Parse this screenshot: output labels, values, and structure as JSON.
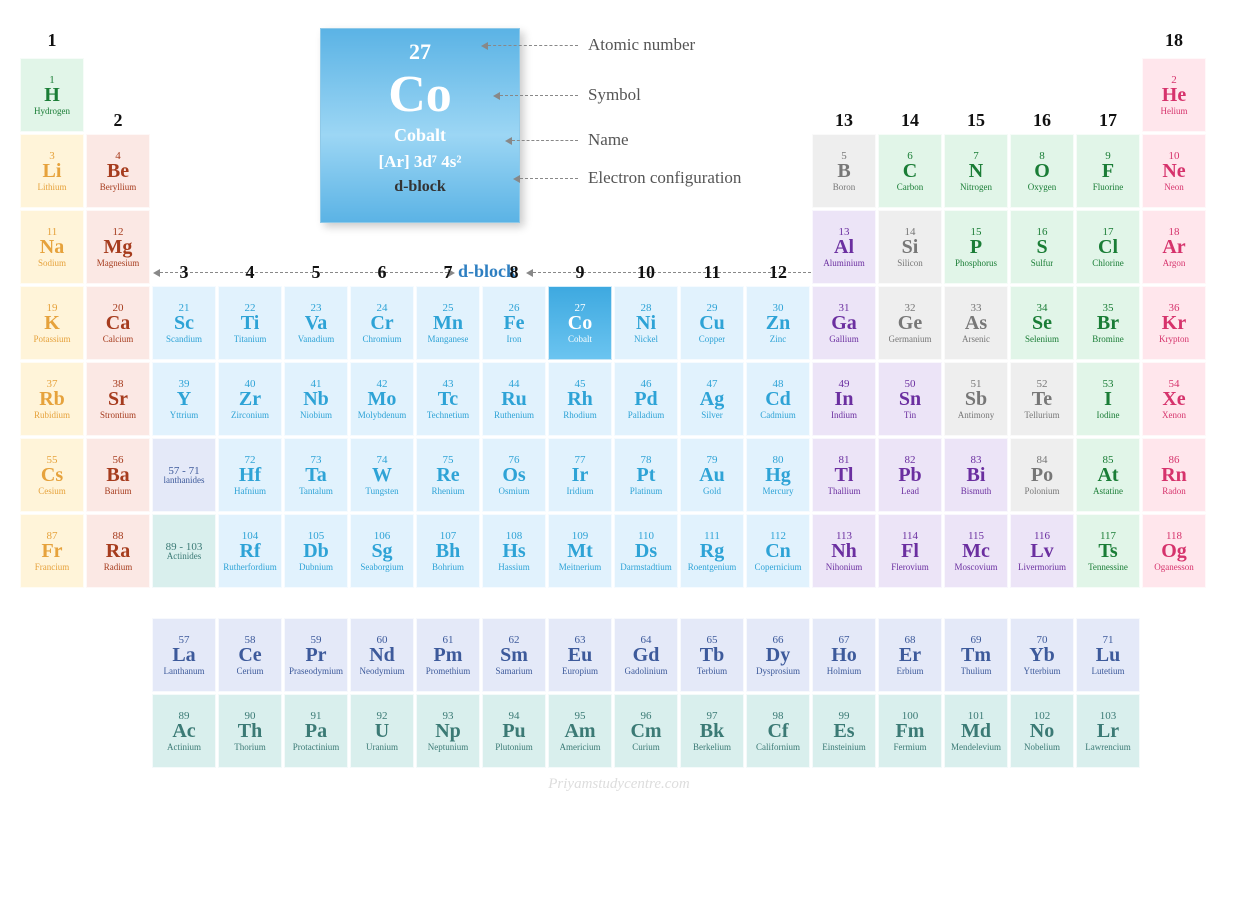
{
  "highlight_element": {
    "number": "27",
    "symbol": "Co",
    "name": "Cobalt",
    "electron_config": "[Ar] 3d⁷ 4s²",
    "block": "d-block"
  },
  "legend": {
    "atomic_number": "Atomic number",
    "symbol": "Symbol",
    "name": "Name",
    "electron_configuration": "Electron configuration"
  },
  "dblock_label": "d-block",
  "watermark": "Priyamstudycentre.com",
  "groups": [
    "1",
    "2",
    "3",
    "4",
    "5",
    "6",
    "7",
    "8",
    "9",
    "10",
    "11",
    "12",
    "13",
    "14",
    "15",
    "16",
    "17",
    "18"
  ],
  "lanth_label": {
    "range": "57 - 71",
    "text": "lanthanides"
  },
  "act_label": {
    "range": "89 - 103",
    "text": "Actinides"
  },
  "elements": [
    {
      "z": 1,
      "s": "H",
      "n": "Hydrogen",
      "cat": "nonmetal",
      "row": 0,
      "col": 0
    },
    {
      "z": 2,
      "s": "He",
      "n": "Helium",
      "cat": "noble",
      "row": 0,
      "col": 17
    },
    {
      "z": 3,
      "s": "Li",
      "n": "Lithium",
      "cat": "alkali",
      "row": 1,
      "col": 0
    },
    {
      "z": 4,
      "s": "Be",
      "n": "Beryllium",
      "cat": "alkearth",
      "row": 1,
      "col": 1
    },
    {
      "z": 5,
      "s": "B",
      "n": "Boron",
      "cat": "metalloid",
      "row": 1,
      "col": 12
    },
    {
      "z": 6,
      "s": "C",
      "n": "Carbon",
      "cat": "nonmetal",
      "row": 1,
      "col": 13
    },
    {
      "z": 7,
      "s": "N",
      "n": "Nitrogen",
      "cat": "nonmetal",
      "row": 1,
      "col": 14
    },
    {
      "z": 8,
      "s": "O",
      "n": "Oxygen",
      "cat": "nonmetal",
      "row": 1,
      "col": 15
    },
    {
      "z": 9,
      "s": "F",
      "n": "Fluorine",
      "cat": "nonmetal",
      "row": 1,
      "col": 16
    },
    {
      "z": 10,
      "s": "Ne",
      "n": "Neon",
      "cat": "noble",
      "row": 1,
      "col": 17
    },
    {
      "z": 11,
      "s": "Na",
      "n": "Sodium",
      "cat": "alkali",
      "row": 2,
      "col": 0
    },
    {
      "z": 12,
      "s": "Mg",
      "n": "Magnesium",
      "cat": "alkearth",
      "row": 2,
      "col": 1
    },
    {
      "z": 13,
      "s": "Al",
      "n": "Aluminium",
      "cat": "ptrans",
      "row": 2,
      "col": 12
    },
    {
      "z": 14,
      "s": "Si",
      "n": "Silicon",
      "cat": "metalloid",
      "row": 2,
      "col": 13
    },
    {
      "z": 15,
      "s": "P",
      "n": "Phosphorus",
      "cat": "nonmetal",
      "row": 2,
      "col": 14
    },
    {
      "z": 16,
      "s": "S",
      "n": "Sulfur",
      "cat": "nonmetal",
      "row": 2,
      "col": 15
    },
    {
      "z": 17,
      "s": "Cl",
      "n": "Chlorine",
      "cat": "nonmetal",
      "row": 2,
      "col": 16
    },
    {
      "z": 18,
      "s": "Ar",
      "n": "Argon",
      "cat": "noble",
      "row": 2,
      "col": 17
    },
    {
      "z": 19,
      "s": "K",
      "n": "Potassium",
      "cat": "alkali",
      "row": 3,
      "col": 0
    },
    {
      "z": 20,
      "s": "Ca",
      "n": "Calcium",
      "cat": "alkearth",
      "row": 3,
      "col": 1
    },
    {
      "z": 21,
      "s": "Sc",
      "n": "Scandium",
      "cat": "trans",
      "row": 3,
      "col": 2
    },
    {
      "z": 22,
      "s": "Ti",
      "n": "Titanium",
      "cat": "trans",
      "row": 3,
      "col": 3
    },
    {
      "z": 23,
      "s": "Va",
      "n": "Vanadium",
      "cat": "trans",
      "row": 3,
      "col": 4
    },
    {
      "z": 24,
      "s": "Cr",
      "n": "Chromium",
      "cat": "trans",
      "row": 3,
      "col": 5
    },
    {
      "z": 25,
      "s": "Mn",
      "n": "Manganese",
      "cat": "trans",
      "row": 3,
      "col": 6
    },
    {
      "z": 26,
      "s": "Fe",
      "n": "Iron",
      "cat": "trans",
      "row": 3,
      "col": 7
    },
    {
      "z": 27,
      "s": "Co",
      "n": "Cobalt",
      "cat": "highlight",
      "row": 3,
      "col": 8
    },
    {
      "z": 28,
      "s": "Ni",
      "n": "Nickel",
      "cat": "trans",
      "row": 3,
      "col": 9
    },
    {
      "z": 29,
      "s": "Cu",
      "n": "Copper",
      "cat": "trans",
      "row": 3,
      "col": 10
    },
    {
      "z": 30,
      "s": "Zn",
      "n": "Zinc",
      "cat": "trans",
      "row": 3,
      "col": 11
    },
    {
      "z": 31,
      "s": "Ga",
      "n": "Gallium",
      "cat": "ptrans",
      "row": 3,
      "col": 12
    },
    {
      "z": 32,
      "s": "Ge",
      "n": "Germanium",
      "cat": "metalloid",
      "row": 3,
      "col": 13
    },
    {
      "z": 33,
      "s": "As",
      "n": "Arsenic",
      "cat": "metalloid",
      "row": 3,
      "col": 14
    },
    {
      "z": 34,
      "s": "Se",
      "n": "Selenium",
      "cat": "nonmetal",
      "row": 3,
      "col": 15
    },
    {
      "z": 35,
      "s": "Br",
      "n": "Bromine",
      "cat": "nonmetal",
      "row": 3,
      "col": 16
    },
    {
      "z": 36,
      "s": "Kr",
      "n": "Krypton",
      "cat": "noble",
      "row": 3,
      "col": 17
    },
    {
      "z": 37,
      "s": "Rb",
      "n": "Rubidium",
      "cat": "alkali",
      "row": 4,
      "col": 0
    },
    {
      "z": 38,
      "s": "Sr",
      "n": "Strontium",
      "cat": "alkearth",
      "row": 4,
      "col": 1
    },
    {
      "z": 39,
      "s": "Y",
      "n": "Yttrium",
      "cat": "trans",
      "row": 4,
      "col": 2
    },
    {
      "z": 40,
      "s": "Zr",
      "n": "Zirconium",
      "cat": "trans",
      "row": 4,
      "col": 3
    },
    {
      "z": 41,
      "s": "Nb",
      "n": "Niobium",
      "cat": "trans",
      "row": 4,
      "col": 4
    },
    {
      "z": 42,
      "s": "Mo",
      "n": "Molybdenum",
      "cat": "trans",
      "row": 4,
      "col": 5
    },
    {
      "z": 43,
      "s": "Tc",
      "n": "Technetium",
      "cat": "trans",
      "row": 4,
      "col": 6
    },
    {
      "z": 44,
      "s": "Ru",
      "n": "Ruthenium",
      "cat": "trans",
      "row": 4,
      "col": 7
    },
    {
      "z": 45,
      "s": "Rh",
      "n": "Rhodium",
      "cat": "trans",
      "row": 4,
      "col": 8
    },
    {
      "z": 46,
      "s": "Pd",
      "n": "Palladium",
      "cat": "trans",
      "row": 4,
      "col": 9
    },
    {
      "z": 47,
      "s": "Ag",
      "n": "Silver",
      "cat": "trans",
      "row": 4,
      "col": 10
    },
    {
      "z": 48,
      "s": "Cd",
      "n": "Cadmium",
      "cat": "trans",
      "row": 4,
      "col": 11
    },
    {
      "z": 49,
      "s": "In",
      "n": "Indium",
      "cat": "ptrans",
      "row": 4,
      "col": 12
    },
    {
      "z": 50,
      "s": "Sn",
      "n": "Tin",
      "cat": "ptrans",
      "row": 4,
      "col": 13
    },
    {
      "z": 51,
      "s": "Sb",
      "n": "Antimony",
      "cat": "metalloid",
      "row": 4,
      "col": 14
    },
    {
      "z": 52,
      "s": "Te",
      "n": "Tellurium",
      "cat": "metalloid",
      "row": 4,
      "col": 15
    },
    {
      "z": 53,
      "s": "I",
      "n": "Iodine",
      "cat": "nonmetal",
      "row": 4,
      "col": 16
    },
    {
      "z": 54,
      "s": "Xe",
      "n": "Xenon",
      "cat": "noble",
      "row": 4,
      "col": 17
    },
    {
      "z": 55,
      "s": "Cs",
      "n": "Cesium",
      "cat": "alkali",
      "row": 5,
      "col": 0
    },
    {
      "z": 56,
      "s": "Ba",
      "n": "Barium",
      "cat": "alkearth",
      "row": 5,
      "col": 1
    },
    {
      "z": 72,
      "s": "Hf",
      "n": "Hafnium",
      "cat": "trans",
      "row": 5,
      "col": 3
    },
    {
      "z": 73,
      "s": "Ta",
      "n": "Tantalum",
      "cat": "trans",
      "row": 5,
      "col": 4
    },
    {
      "z": 74,
      "s": "W",
      "n": "Tungsten",
      "cat": "trans",
      "row": 5,
      "col": 5
    },
    {
      "z": 75,
      "s": "Re",
      "n": "Rhenium",
      "cat": "trans",
      "row": 5,
      "col": 6
    },
    {
      "z": 76,
      "s": "Os",
      "n": "Osmium",
      "cat": "trans",
      "row": 5,
      "col": 7
    },
    {
      "z": 77,
      "s": "Ir",
      "n": "Iridium",
      "cat": "trans",
      "row": 5,
      "col": 8
    },
    {
      "z": 78,
      "s": "Pt",
      "n": "Platinum",
      "cat": "trans",
      "row": 5,
      "col": 9
    },
    {
      "z": 79,
      "s": "Au",
      "n": "Gold",
      "cat": "trans",
      "row": 5,
      "col": 10
    },
    {
      "z": 80,
      "s": "Hg",
      "n": "Mercury",
      "cat": "trans",
      "row": 5,
      "col": 11
    },
    {
      "z": 81,
      "s": "Tl",
      "n": "Thallium",
      "cat": "ptrans",
      "row": 5,
      "col": 12
    },
    {
      "z": 82,
      "s": "Pb",
      "n": "Lead",
      "cat": "ptrans",
      "row": 5,
      "col": 13
    },
    {
      "z": 83,
      "s": "Bi",
      "n": "Bismuth",
      "cat": "ptrans",
      "row": 5,
      "col": 14
    },
    {
      "z": 84,
      "s": "Po",
      "n": "Polonium",
      "cat": "metalloid",
      "row": 5,
      "col": 15
    },
    {
      "z": 85,
      "s": "At",
      "n": "Astatine",
      "cat": "nonmetal",
      "row": 5,
      "col": 16
    },
    {
      "z": 86,
      "s": "Rn",
      "n": "Radon",
      "cat": "noble",
      "row": 5,
      "col": 17
    },
    {
      "z": 87,
      "s": "Fr",
      "n": "Francium",
      "cat": "alkali",
      "row": 6,
      "col": 0
    },
    {
      "z": 88,
      "s": "Ra",
      "n": "Radium",
      "cat": "alkearth",
      "row": 6,
      "col": 1
    },
    {
      "z": 104,
      "s": "Rf",
      "n": "Rutherfordium",
      "cat": "trans",
      "row": 6,
      "col": 3
    },
    {
      "z": 105,
      "s": "Db",
      "n": "Dubnium",
      "cat": "trans",
      "row": 6,
      "col": 4
    },
    {
      "z": 106,
      "s": "Sg",
      "n": "Seaborgium",
      "cat": "trans",
      "row": 6,
      "col": 5
    },
    {
      "z": 107,
      "s": "Bh",
      "n": "Bohrium",
      "cat": "trans",
      "row": 6,
      "col": 6
    },
    {
      "z": 108,
      "s": "Hs",
      "n": "Hassium",
      "cat": "trans",
      "row": 6,
      "col": 7
    },
    {
      "z": 109,
      "s": "Mt",
      "n": "Meitnerium",
      "cat": "trans",
      "row": 6,
      "col": 8
    },
    {
      "z": 110,
      "s": "Ds",
      "n": "Darmstadtium",
      "cat": "trans",
      "row": 6,
      "col": 9
    },
    {
      "z": 111,
      "s": "Rg",
      "n": "Roentgenium",
      "cat": "trans",
      "row": 6,
      "col": 10
    },
    {
      "z": 112,
      "s": "Cn",
      "n": "Copernicium",
      "cat": "trans",
      "row": 6,
      "col": 11
    },
    {
      "z": 113,
      "s": "Nh",
      "n": "Nihonium",
      "cat": "ptrans",
      "row": 6,
      "col": 12
    },
    {
      "z": 114,
      "s": "Fl",
      "n": "Flerovium",
      "cat": "ptrans",
      "row": 6,
      "col": 13
    },
    {
      "z": 115,
      "s": "Mc",
      "n": "Moscovium",
      "cat": "ptrans",
      "row": 6,
      "col": 14
    },
    {
      "z": 116,
      "s": "Lv",
      "n": "Livermorium",
      "cat": "ptrans",
      "row": 6,
      "col": 15
    },
    {
      "z": 117,
      "s": "Ts",
      "n": "Tennessine",
      "cat": "nonmetal",
      "row": 6,
      "col": 16
    },
    {
      "z": 118,
      "s": "Og",
      "n": "Oganesson",
      "cat": "noble",
      "row": 6,
      "col": 17
    }
  ],
  "lanthanides": [
    {
      "z": 57,
      "s": "La",
      "n": "Lanthanum"
    },
    {
      "z": 58,
      "s": "Ce",
      "n": "Cerium"
    },
    {
      "z": 59,
      "s": "Pr",
      "n": "Praseodymium"
    },
    {
      "z": 60,
      "s": "Nd",
      "n": "Neodymium"
    },
    {
      "z": 61,
      "s": "Pm",
      "n": "Promethium"
    },
    {
      "z": 62,
      "s": "Sm",
      "n": "Samarium"
    },
    {
      "z": 63,
      "s": "Eu",
      "n": "Europium"
    },
    {
      "z": 64,
      "s": "Gd",
      "n": "Gadolinium"
    },
    {
      "z": 65,
      "s": "Tb",
      "n": "Terbium"
    },
    {
      "z": 66,
      "s": "Dy",
      "n": "Dysprosium"
    },
    {
      "z": 67,
      "s": "Ho",
      "n": "Holmium"
    },
    {
      "z": 68,
      "s": "Er",
      "n": "Erbium"
    },
    {
      "z": 69,
      "s": "Tm",
      "n": "Thulium"
    },
    {
      "z": 70,
      "s": "Yb",
      "n": "Ytterbium"
    },
    {
      "z": 71,
      "s": "Lu",
      "n": "Lutetium"
    }
  ],
  "actinides": [
    {
      "z": 89,
      "s": "Ac",
      "n": "Actinium"
    },
    {
      "z": 90,
      "s": "Th",
      "n": "Thorium"
    },
    {
      "z": 91,
      "s": "Pa",
      "n": "Protactinium"
    },
    {
      "z": 92,
      "s": "U",
      "n": "Uranium"
    },
    {
      "z": 93,
      "s": "Np",
      "n": "Neptunium"
    },
    {
      "z": 94,
      "s": "Pu",
      "n": "Plutonium"
    },
    {
      "z": 95,
      "s": "Am",
      "n": "Americium"
    },
    {
      "z": 96,
      "s": "Cm",
      "n": "Curium"
    },
    {
      "z": 97,
      "s": "Bk",
      "n": "Berkelium"
    },
    {
      "z": 98,
      "s": "Cf",
      "n": "Californium"
    },
    {
      "z": 99,
      "s": "Es",
      "n": "Einsteinium"
    },
    {
      "z": 100,
      "s": "Fm",
      "n": "Fermium"
    },
    {
      "z": 101,
      "s": "Md",
      "n": "Mendelevium"
    },
    {
      "z": 102,
      "s": "No",
      "n": "Nobelium"
    },
    {
      "z": 103,
      "s": "Lr",
      "n": "Lawrencium"
    }
  ]
}
